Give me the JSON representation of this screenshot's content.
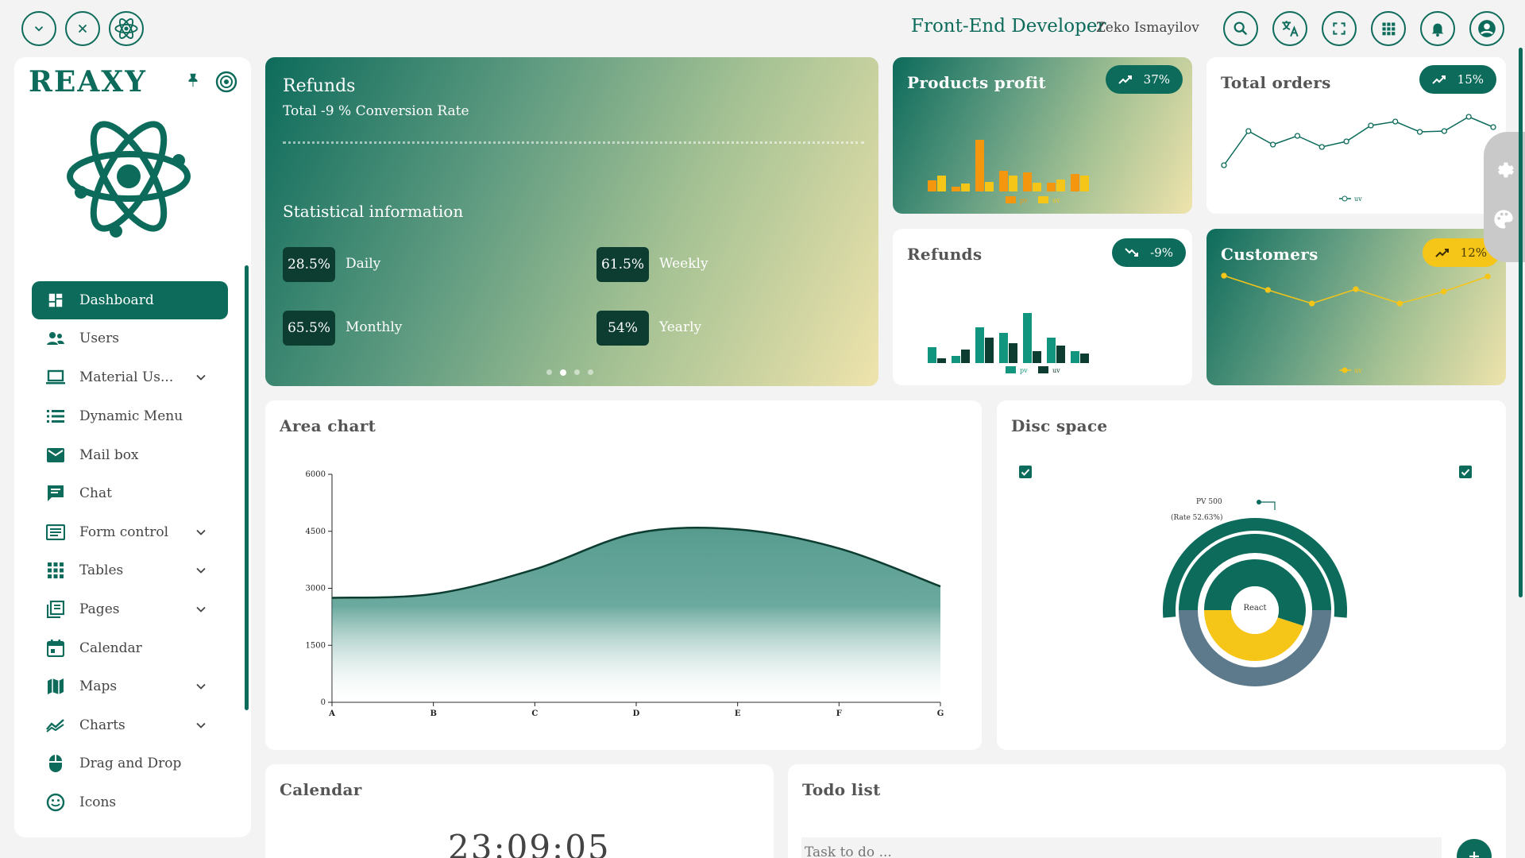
{
  "header": {
    "role": "Front-End Developer",
    "user_name": "Zeko Ismayilov"
  },
  "sidebar": {
    "brand": "REAXY",
    "items": [
      {
        "label": "Dashboard",
        "icon": "dashboard-icon",
        "active": true
      },
      {
        "label": "Users",
        "icon": "users-icon"
      },
      {
        "label": "Material Us...",
        "icon": "laptop-icon",
        "expandable": true
      },
      {
        "label": "Dynamic Menu",
        "icon": "list-icon"
      },
      {
        "label": "Mail box",
        "icon": "mail-icon"
      },
      {
        "label": "Chat",
        "icon": "chat-icon"
      },
      {
        "label": "Form control",
        "icon": "form-icon",
        "expandable": true
      },
      {
        "label": "Tables",
        "icon": "grid-icon",
        "expandable": true
      },
      {
        "label": "Pages",
        "icon": "pages-icon",
        "expandable": true
      },
      {
        "label": "Calendar",
        "icon": "calendar-icon"
      },
      {
        "label": "Maps",
        "icon": "map-icon",
        "expandable": true
      },
      {
        "label": "Charts",
        "icon": "chart-icon",
        "expandable": true
      },
      {
        "label": "Drag and Drop",
        "icon": "mouse-icon"
      },
      {
        "label": "Icons",
        "icon": "smile-icon"
      }
    ]
  },
  "refunds_banner": {
    "title": "Refunds",
    "subtitle": "Total -9 % Conversion Rate",
    "section_title": "Statistical information",
    "stats": [
      {
        "value": "28.5%",
        "label": "Daily"
      },
      {
        "value": "61.5%",
        "label": "Weekly"
      },
      {
        "value": "65.5%",
        "label": "Monthly"
      },
      {
        "value": "54%",
        "label": "Yearly"
      }
    ]
  },
  "products_profit": {
    "title": "Products profit",
    "badge": "37%",
    "legend": [
      "pv",
      "uv"
    ]
  },
  "total_orders": {
    "title": "Total orders",
    "badge": "15%",
    "legend": [
      "uv"
    ]
  },
  "refunds_card": {
    "title": "Refunds",
    "badge": "-9%",
    "legend": [
      "pv",
      "uv"
    ]
  },
  "customers": {
    "title": "Customers",
    "badge": "12%",
    "legend": [
      "uv"
    ]
  },
  "area_chart": {
    "title": "Area chart"
  },
  "disc_space": {
    "title": "Disc space",
    "center_label": "React",
    "tooltip_line1": "PV 500",
    "tooltip_line2": "(Rate 52.63%)"
  },
  "calendar": {
    "title": "Calendar",
    "time": "23:09:05"
  },
  "todo": {
    "title": "Todo list",
    "placeholder": "Task to do ..."
  },
  "colors": {
    "primary": "#0c6b5a",
    "dark": "#0d3d31",
    "orange": "#f5960f",
    "yellow": "#f5c518",
    "teal": "#11957f",
    "slate": "#5d7a8c"
  },
  "chart_data": [
    {
      "type": "area",
      "title": "Area chart",
      "categories": [
        "A",
        "B",
        "C",
        "D",
        "E",
        "F",
        "G"
      ],
      "values": [
        2750,
        2850,
        3500,
        4450,
        4550,
        4050,
        3050
      ],
      "ylim": [
        0,
        6000
      ],
      "yticks": [
        0,
        1500,
        3000,
        4500,
        6000
      ]
    },
    {
      "type": "bar",
      "title": "Products profit",
      "series": [
        {
          "name": "pv",
          "values": [
            14,
            6,
            65,
            26,
            24,
            11,
            22
          ]
        },
        {
          "name": "uv",
          "values": [
            20,
            10,
            12,
            20,
            11,
            15,
            20
          ]
        }
      ]
    },
    {
      "type": "line",
      "title": "Total orders",
      "series": [
        {
          "name": "uv",
          "values": [
            12,
            55,
            38,
            49,
            35,
            42,
            62,
            67,
            54,
            55,
            73,
            60
          ]
        }
      ]
    },
    {
      "type": "bar",
      "title": "Refunds",
      "series": [
        {
          "name": "pv",
          "values": [
            20,
            9,
            45,
            38,
            63,
            32,
            15
          ]
        },
        {
          "name": "uv",
          "values": [
            6,
            17,
            32,
            25,
            15,
            22,
            12
          ]
        }
      ]
    },
    {
      "type": "line",
      "title": "Customers",
      "series": [
        {
          "name": "uv",
          "values": [
            75,
            57,
            40,
            58,
            40,
            55,
            74
          ]
        }
      ]
    },
    {
      "type": "pie",
      "title": "Disc space",
      "rings": [
        {
          "name": "outer",
          "slices": [
            {
              "label": "PV 500",
              "value": 500,
              "rate": "52.63%"
            }
          ]
        },
        {
          "name": "middle",
          "slices": [
            {
              "value": 50
            },
            {
              "value": 50
            }
          ]
        },
        {
          "name": "inner",
          "slices": [
            {
              "value": 55
            },
            {
              "value": 45
            }
          ]
        }
      ]
    }
  ]
}
